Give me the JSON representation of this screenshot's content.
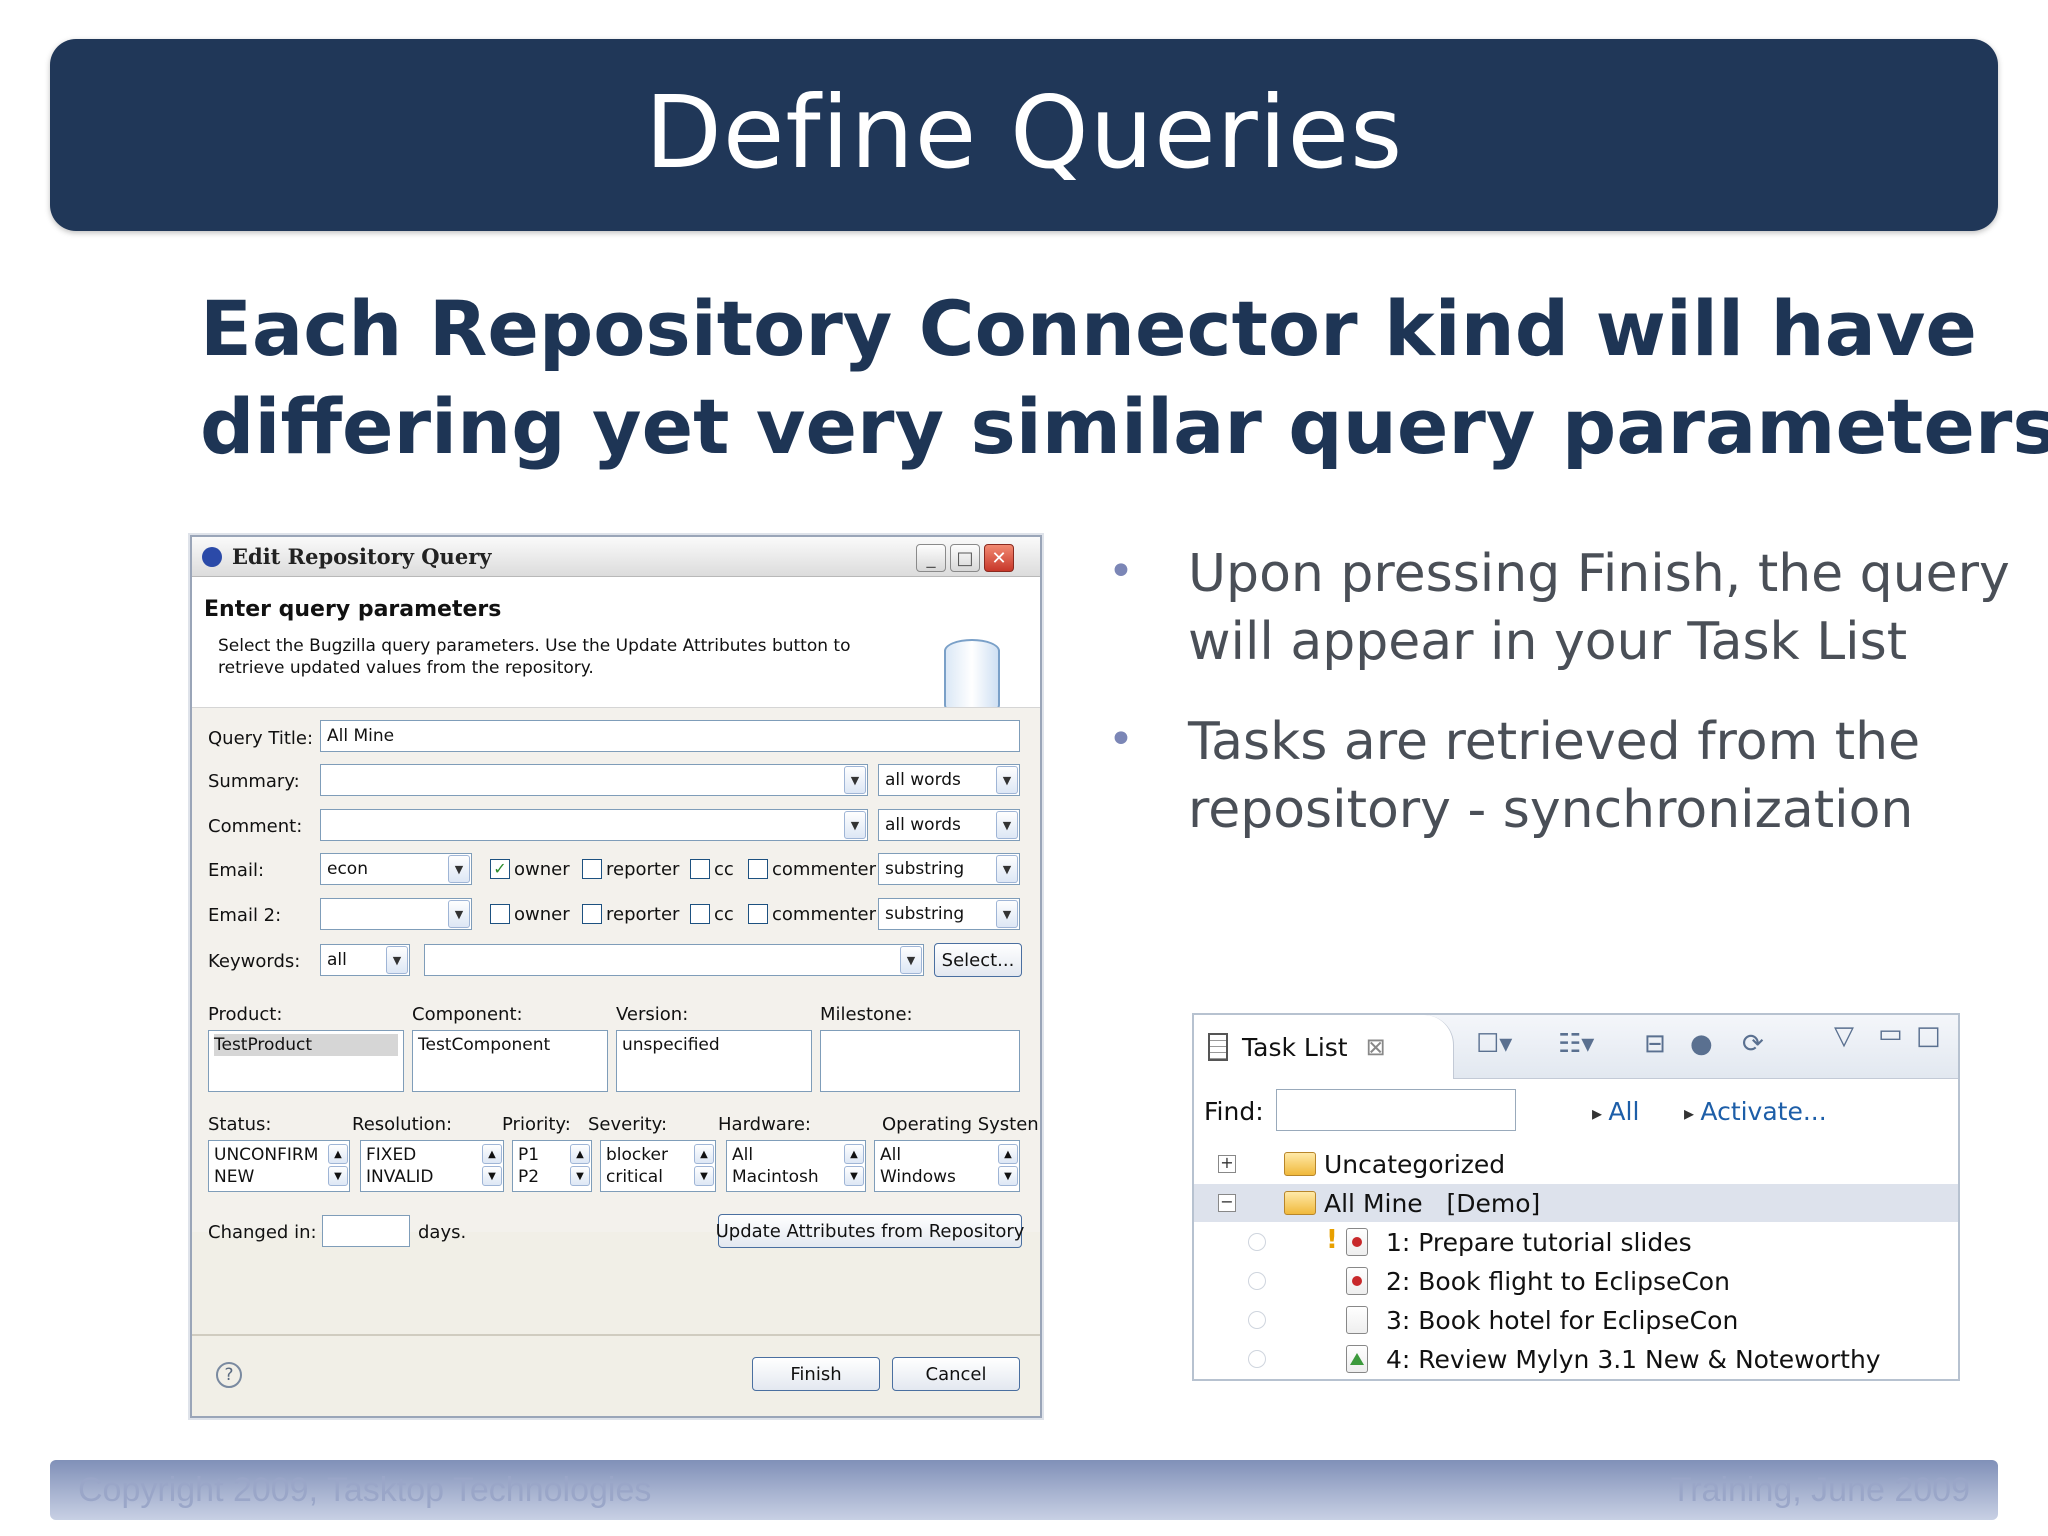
{
  "slide": {
    "title": "Define Queries",
    "headline_lines": [
      "Each Repository Connector kind will have",
      "differing yet very similar query parameters"
    ],
    "bullets": [
      "Upon pressing Finish, the query will appear in your Task List",
      "Tasks are retrieved from the repository - synchronization"
    ],
    "footer_left": "Copyright 2009, Tasktop Technologies",
    "footer_right": "Training, June 2009"
  },
  "dialog": {
    "title": "Edit Repository Query",
    "header_title": "Enter query parameters",
    "header_desc": "Select the Bugzilla query parameters.  Use the Update Attributes button to retrieve updated values from the repository.",
    "query_title_label": "Query Title:",
    "query_title_value": "All Mine",
    "summary_label": "Summary:",
    "summary_mode": "all words",
    "comment_label": "Comment:",
    "comment_mode": "all words",
    "email_label": "Email:",
    "email_value": "econ",
    "email2_label": "Email 2:",
    "email_roles": [
      "owner",
      "reporter",
      "cc",
      "commenter"
    ],
    "email_mode": "substring",
    "email2_mode": "substring",
    "keywords_label": "Keywords:",
    "keywords_mode": "all",
    "select_button": "Select...",
    "product_label": "Product:",
    "component_label": "Component:",
    "version_label": "Version:",
    "milestone_label": "Milestone:",
    "product_value": "TestProduct",
    "component_value": "TestComponent",
    "version_value": "unspecified",
    "status_label": "Status:",
    "resolution_label": "Resolution:",
    "priority_label": "Priority:",
    "severity_label": "Severity:",
    "hardware_label": "Hardware:",
    "os_label": "Operating Systen",
    "status_values": [
      "UNCONFIRM",
      "NEW"
    ],
    "resolution_values": [
      "FIXED",
      "INVALID"
    ],
    "priority_values": [
      "P1",
      "P2"
    ],
    "severity_values": [
      "blocker",
      "critical"
    ],
    "hardware_values": [
      "All",
      "Macintosh"
    ],
    "os_values": [
      "All",
      "Windows"
    ],
    "changed_in_label": "Changed in:",
    "days_label": "days.",
    "update_button": "Update Attributes from Repository",
    "finish_button": "Finish",
    "cancel_button": "Cancel",
    "help_glyph": "?"
  },
  "tasklist": {
    "tab_label": "Task List",
    "find_label": "Find:",
    "link_all": "All",
    "link_activate": "Activate...",
    "categories": [
      "Uncategorized",
      "All Mine   [Demo]"
    ],
    "tasks": [
      "1: Prepare tutorial slides",
      "2: Book flight to EclipseCon",
      "3: Book hotel for EclipseCon",
      "4: Review Mylyn 3.1 New & Noteworthy"
    ]
  }
}
